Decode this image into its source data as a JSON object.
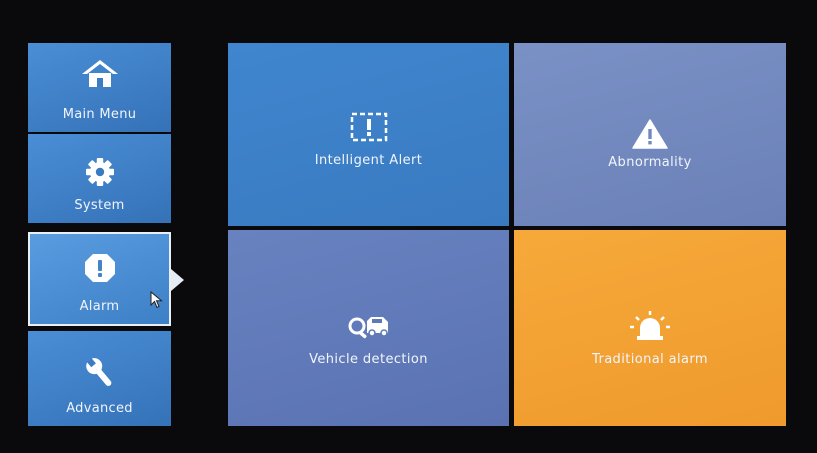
{
  "sidebar": {
    "items": [
      {
        "label": "Main Menu",
        "icon": "home-icon"
      },
      {
        "label": "System",
        "icon": "gear-icon"
      },
      {
        "label": "Alarm",
        "icon": "alert-icon",
        "selected": true
      },
      {
        "label": "Advanced",
        "icon": "wrench-icon"
      }
    ]
  },
  "tiles": [
    {
      "label": "Intelligent Alert",
      "icon": "intelligent-alert-icon",
      "color": "#3c7fc6"
    },
    {
      "label": "Abnormality",
      "icon": "warning-triangle-icon",
      "color": "#7288bf"
    },
    {
      "label": "Vehicle detection",
      "icon": "vehicle-search-icon",
      "color": "#6079b8"
    },
    {
      "label": "Traditional alarm",
      "icon": "siren-icon",
      "color": "#f2a033"
    }
  ]
}
